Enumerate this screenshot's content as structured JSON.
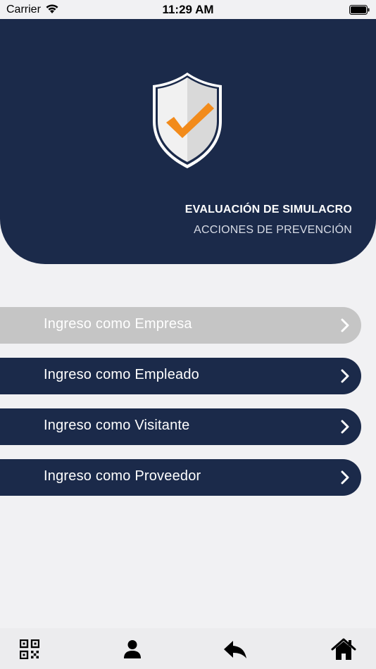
{
  "status_bar": {
    "carrier": "Carrier",
    "time": "11:29 AM"
  },
  "header": {
    "title": "EVALUACIÓN DE SIMULACRO",
    "subtitle": "ACCIONES DE PREVENCIÓN",
    "background_color": "#1b2a4a",
    "logo_icon": "shield-check-icon",
    "check_color": "#f28b1b"
  },
  "menu": {
    "items": [
      {
        "label": "Ingreso como Empresa",
        "state": "disabled",
        "color": "#c5c5c5"
      },
      {
        "label": "Ingreso como Empleado",
        "state": "enabled",
        "color": "#1b2a4a"
      },
      {
        "label": "Ingreso como Visitante",
        "state": "enabled",
        "color": "#1b2a4a"
      },
      {
        "label": "Ingreso como Proveedor",
        "state": "enabled",
        "color": "#1b2a4a"
      }
    ]
  },
  "tab_bar": {
    "tabs": [
      {
        "icon": "qr-code-icon"
      },
      {
        "icon": "person-icon"
      },
      {
        "icon": "reply-arrow-icon"
      },
      {
        "icon": "home-icon"
      }
    ]
  }
}
